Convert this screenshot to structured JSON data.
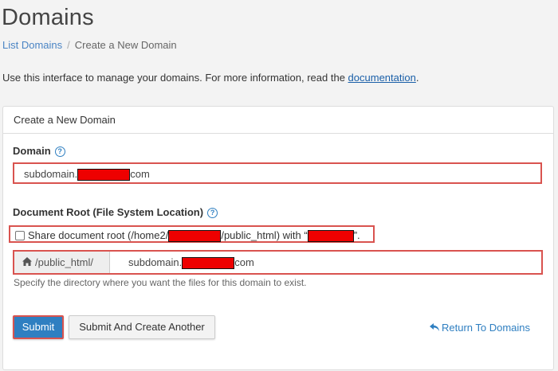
{
  "page": {
    "title": "Domains"
  },
  "breadcrumb": {
    "parent": "List Domains",
    "separator": "/",
    "current": "Create a New Domain"
  },
  "intro": {
    "text": "Use this interface to manage your domains. For more information, read the ",
    "link": "documentation",
    "suffix": "."
  },
  "panel": {
    "heading": "Create a New Domain"
  },
  "domain_field": {
    "label": "Domain",
    "value_prefix": "subdomain.",
    "value_suffix": "com"
  },
  "docroot": {
    "label": "Document Root (File System Location)",
    "share_checkbox": {
      "checked": false,
      "text_prefix": "Share document root (/home2/",
      "text_middle": "/public_html) with “",
      "text_suffix": "”."
    },
    "addon": "/public_html/",
    "value_prefix": "subdomain.",
    "value_suffix": "com",
    "hint": "Specify the directory where you want the files for this domain to exist."
  },
  "buttons": {
    "submit": "Submit",
    "submit_another": "Submit And Create Another",
    "return": "Return To Domains"
  },
  "colors": {
    "accent": "#2f7fc1",
    "highlight": "#d9534f",
    "redaction": "#ee0000"
  },
  "icons": {
    "help": "question-circle-icon",
    "home": "home-icon",
    "return": "reply-arrow-icon"
  }
}
